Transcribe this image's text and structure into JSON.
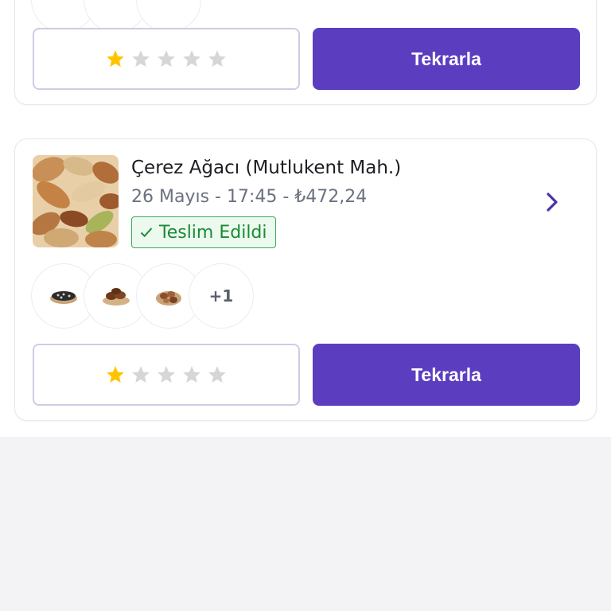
{
  "orders": [
    {
      "rating": {
        "filled": 1,
        "total": 5
      },
      "repeat_label": "Tekrarla"
    },
    {
      "store_name": "Çerez Ağacı (Mutlukent Mah.)",
      "date_time_price": "26 Mayıs - 17:45 - ₺472,24",
      "status": "Teslim Edildi",
      "extra_items": "+1",
      "rating": {
        "filled": 1,
        "total": 5
      },
      "repeat_label": "Tekrarla"
    }
  ],
  "icons": {
    "star_filled": "star-icon",
    "star_empty": "star-outline-icon",
    "check": "check-icon",
    "chevron": "chevron-right-icon"
  },
  "colors": {
    "accent": "#5b3ec0",
    "star_filled": "#ffc400",
    "star_empty": "#d6d6d6",
    "status_green": "#1b8b33",
    "background": "#f3f3f5"
  }
}
